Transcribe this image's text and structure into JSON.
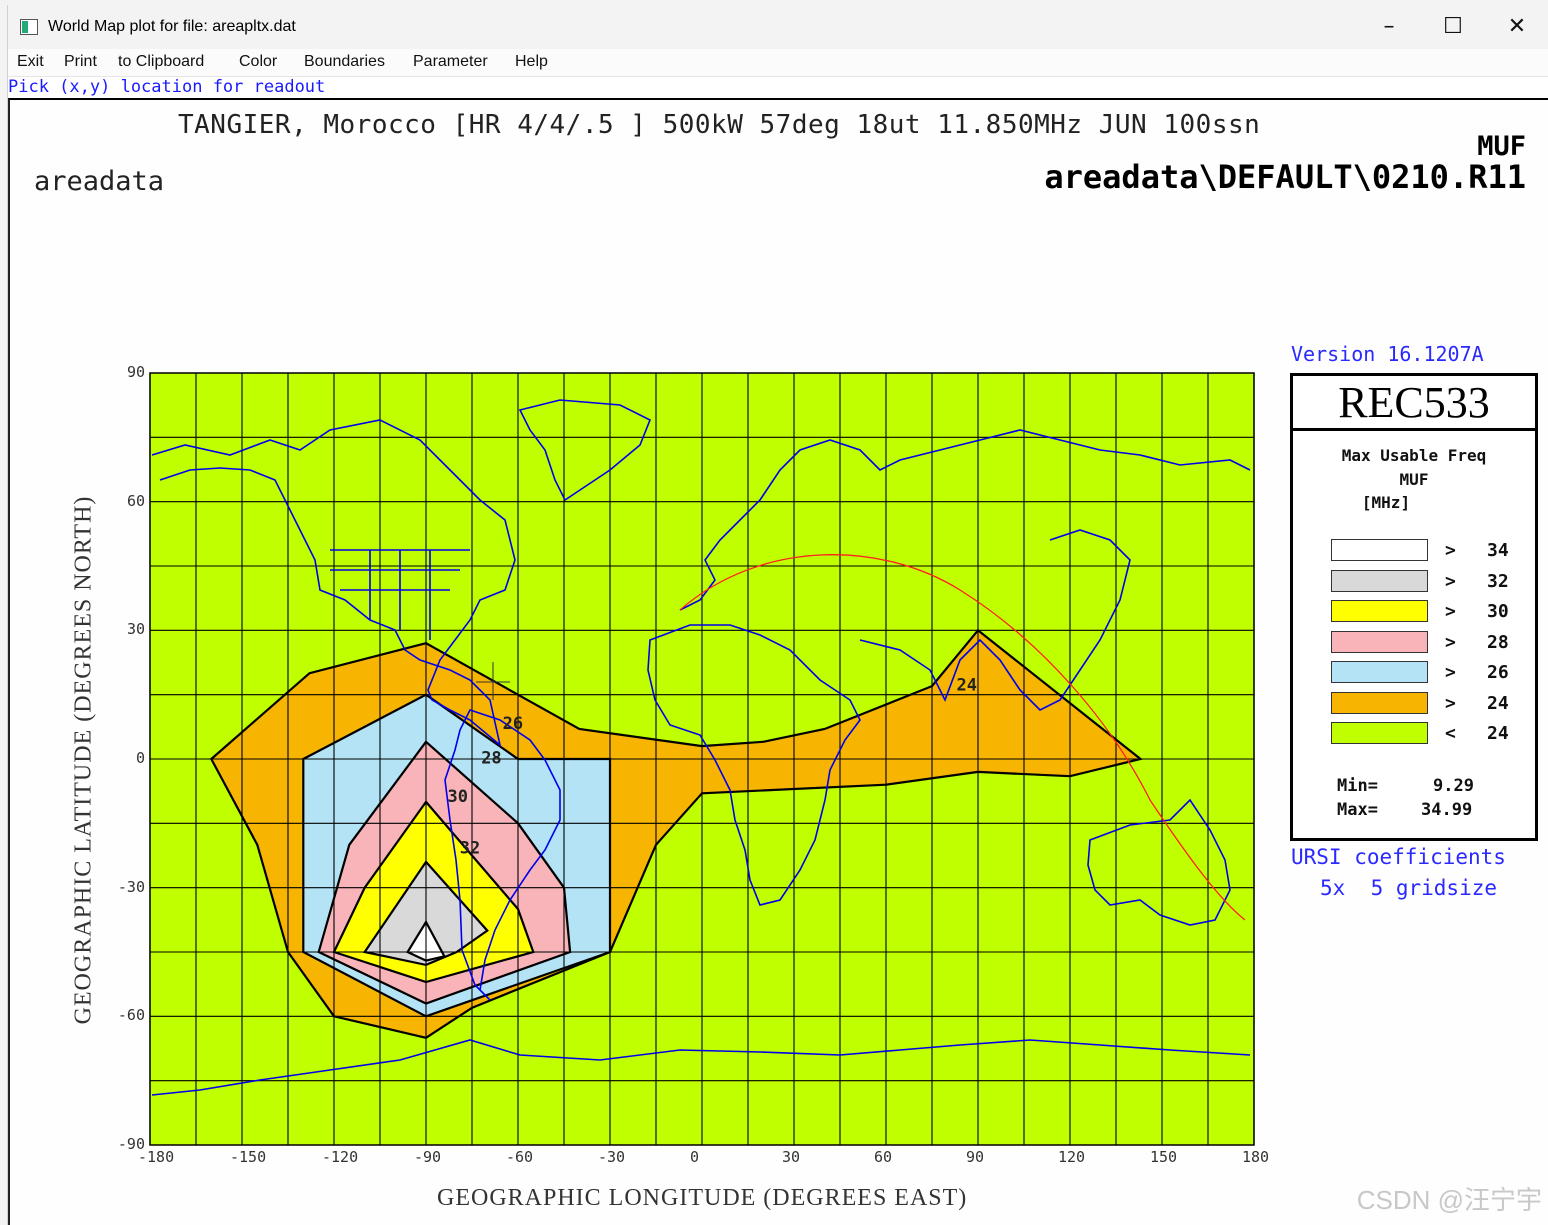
{
  "window": {
    "title": "World Map plot for file: areapltx.dat",
    "controls": [
      "–",
      "☐",
      "✕"
    ]
  },
  "menu": [
    "Exit",
    "Print",
    "to Clipboard",
    "Color",
    "Boundaries",
    "Parameter",
    "Help"
  ],
  "hint": "Pick (x,y) location for readout",
  "plot": {
    "title": "TANGIER, Morocco [HR 4/4/.5 ] 500kW 57deg 18ut 11.850MHz JUN 100ssn",
    "left_label": "areadata",
    "parameter": "MUF",
    "file": "areadata\\DEFAULT\\0210.R11",
    "x_axis_label": "GEOGRAPHIC LONGITUDE (DEGREES EAST)",
    "y_axis_label": "GEOGRAPHIC LATITUDE (DEGREES NORTH)",
    "x_ticks": [
      "-180",
      "-150",
      "-120",
      "-90",
      "-60",
      "-30",
      "0",
      "30",
      "60",
      "90",
      "120",
      "150",
      "180"
    ],
    "y_ticks": [
      "90",
      "60",
      "30",
      "0",
      "-30",
      "-60",
      "-90"
    ],
    "contour_labels": [
      "24",
      "26",
      "28",
      "30",
      "32"
    ]
  },
  "sidebar": {
    "version": "Version 16.1207A",
    "method": "REC533",
    "legend_title": [
      "Max Usable Freq",
      "MUF",
      "[MHz]"
    ],
    "legend": [
      {
        "color": "#ffffff",
        "op": ">",
        "value": "34"
      },
      {
        "color": "#d9d9d9",
        "op": ">",
        "value": "32"
      },
      {
        "color": "#ffff00",
        "op": ">",
        "value": "30"
      },
      {
        "color": "#f8b4b8",
        "op": ">",
        "value": "28"
      },
      {
        "color": "#b3e3f5",
        "op": ">",
        "value": "26"
      },
      {
        "color": "#f7b400",
        "op": ">",
        "value": "24"
      },
      {
        "color": "#bfff00",
        "op": "<",
        "value": "24"
      }
    ],
    "min_label": "Min=",
    "min_value": "9.29",
    "max_label": "Max=",
    "max_value": "34.99",
    "coeff": "URSI coefficients",
    "grid": "5x  5 gridsize"
  },
  "watermark": "CSDN @汪宁宇",
  "chart_data": {
    "type": "heatmap",
    "xlim": [
      -180,
      180
    ],
    "ylim": [
      -90,
      90
    ],
    "grid_step_deg": 15,
    "contour_levels_mhz": [
      24,
      26,
      28,
      30,
      32,
      34
    ],
    "contours": [
      {
        "level": 24,
        "points": [
          [
            -160,
            0
          ],
          [
            -128,
            20
          ],
          [
            -90,
            27
          ],
          [
            -40,
            7
          ],
          [
            0,
            3
          ],
          [
            20,
            4
          ],
          [
            40,
            7
          ],
          [
            75,
            17
          ],
          [
            90,
            30
          ],
          [
            143,
            0
          ],
          [
            120,
            -4
          ],
          [
            90,
            -3
          ],
          [
            60,
            -6
          ],
          [
            0,
            -8
          ],
          [
            -15,
            -20
          ],
          [
            -30,
            -45
          ],
          [
            -75,
            -58
          ],
          [
            -90,
            -65
          ],
          [
            -120,
            -60
          ],
          [
            -135,
            -45
          ],
          [
            -145,
            -20
          ]
        ]
      },
      {
        "level": 26,
        "points": [
          [
            -130,
            0
          ],
          [
            -90,
            15
          ],
          [
            -60,
            0
          ],
          [
            -30,
            0
          ],
          [
            -30,
            -45
          ],
          [
            -90,
            -60
          ],
          [
            -130,
            -45
          ]
        ]
      },
      {
        "level": 28,
        "points": [
          [
            -90,
            4
          ],
          [
            -60,
            -15
          ],
          [
            -45,
            -30
          ],
          [
            -43,
            -45
          ],
          [
            -90,
            -57
          ],
          [
            -125,
            -45
          ],
          [
            -115,
            -20
          ]
        ]
      },
      {
        "level": 30,
        "points": [
          [
            -90,
            -10
          ],
          [
            -60,
            -35
          ],
          [
            -55,
            -45
          ],
          [
            -90,
            -52
          ],
          [
            -120,
            -45
          ],
          [
            -110,
            -30
          ]
        ]
      },
      {
        "level": 32,
        "points": [
          [
            -90,
            -24
          ],
          [
            -70,
            -40
          ],
          [
            -80,
            -45
          ],
          [
            -90,
            -48
          ],
          [
            -110,
            -45
          ]
        ]
      },
      {
        "level": 34,
        "points": [
          [
            -90,
            -38
          ],
          [
            -84,
            -46
          ],
          [
            -90,
            -47
          ],
          [
            -96,
            -45
          ]
        ]
      }
    ],
    "min": 9.29,
    "max": 34.99,
    "transmitter": "TANGIER, Morocco",
    "frequency_mhz": 11.85,
    "power_kw": 500,
    "azimuth_deg": 57,
    "time_ut": 18,
    "month": "JUN",
    "ssn": 100
  }
}
